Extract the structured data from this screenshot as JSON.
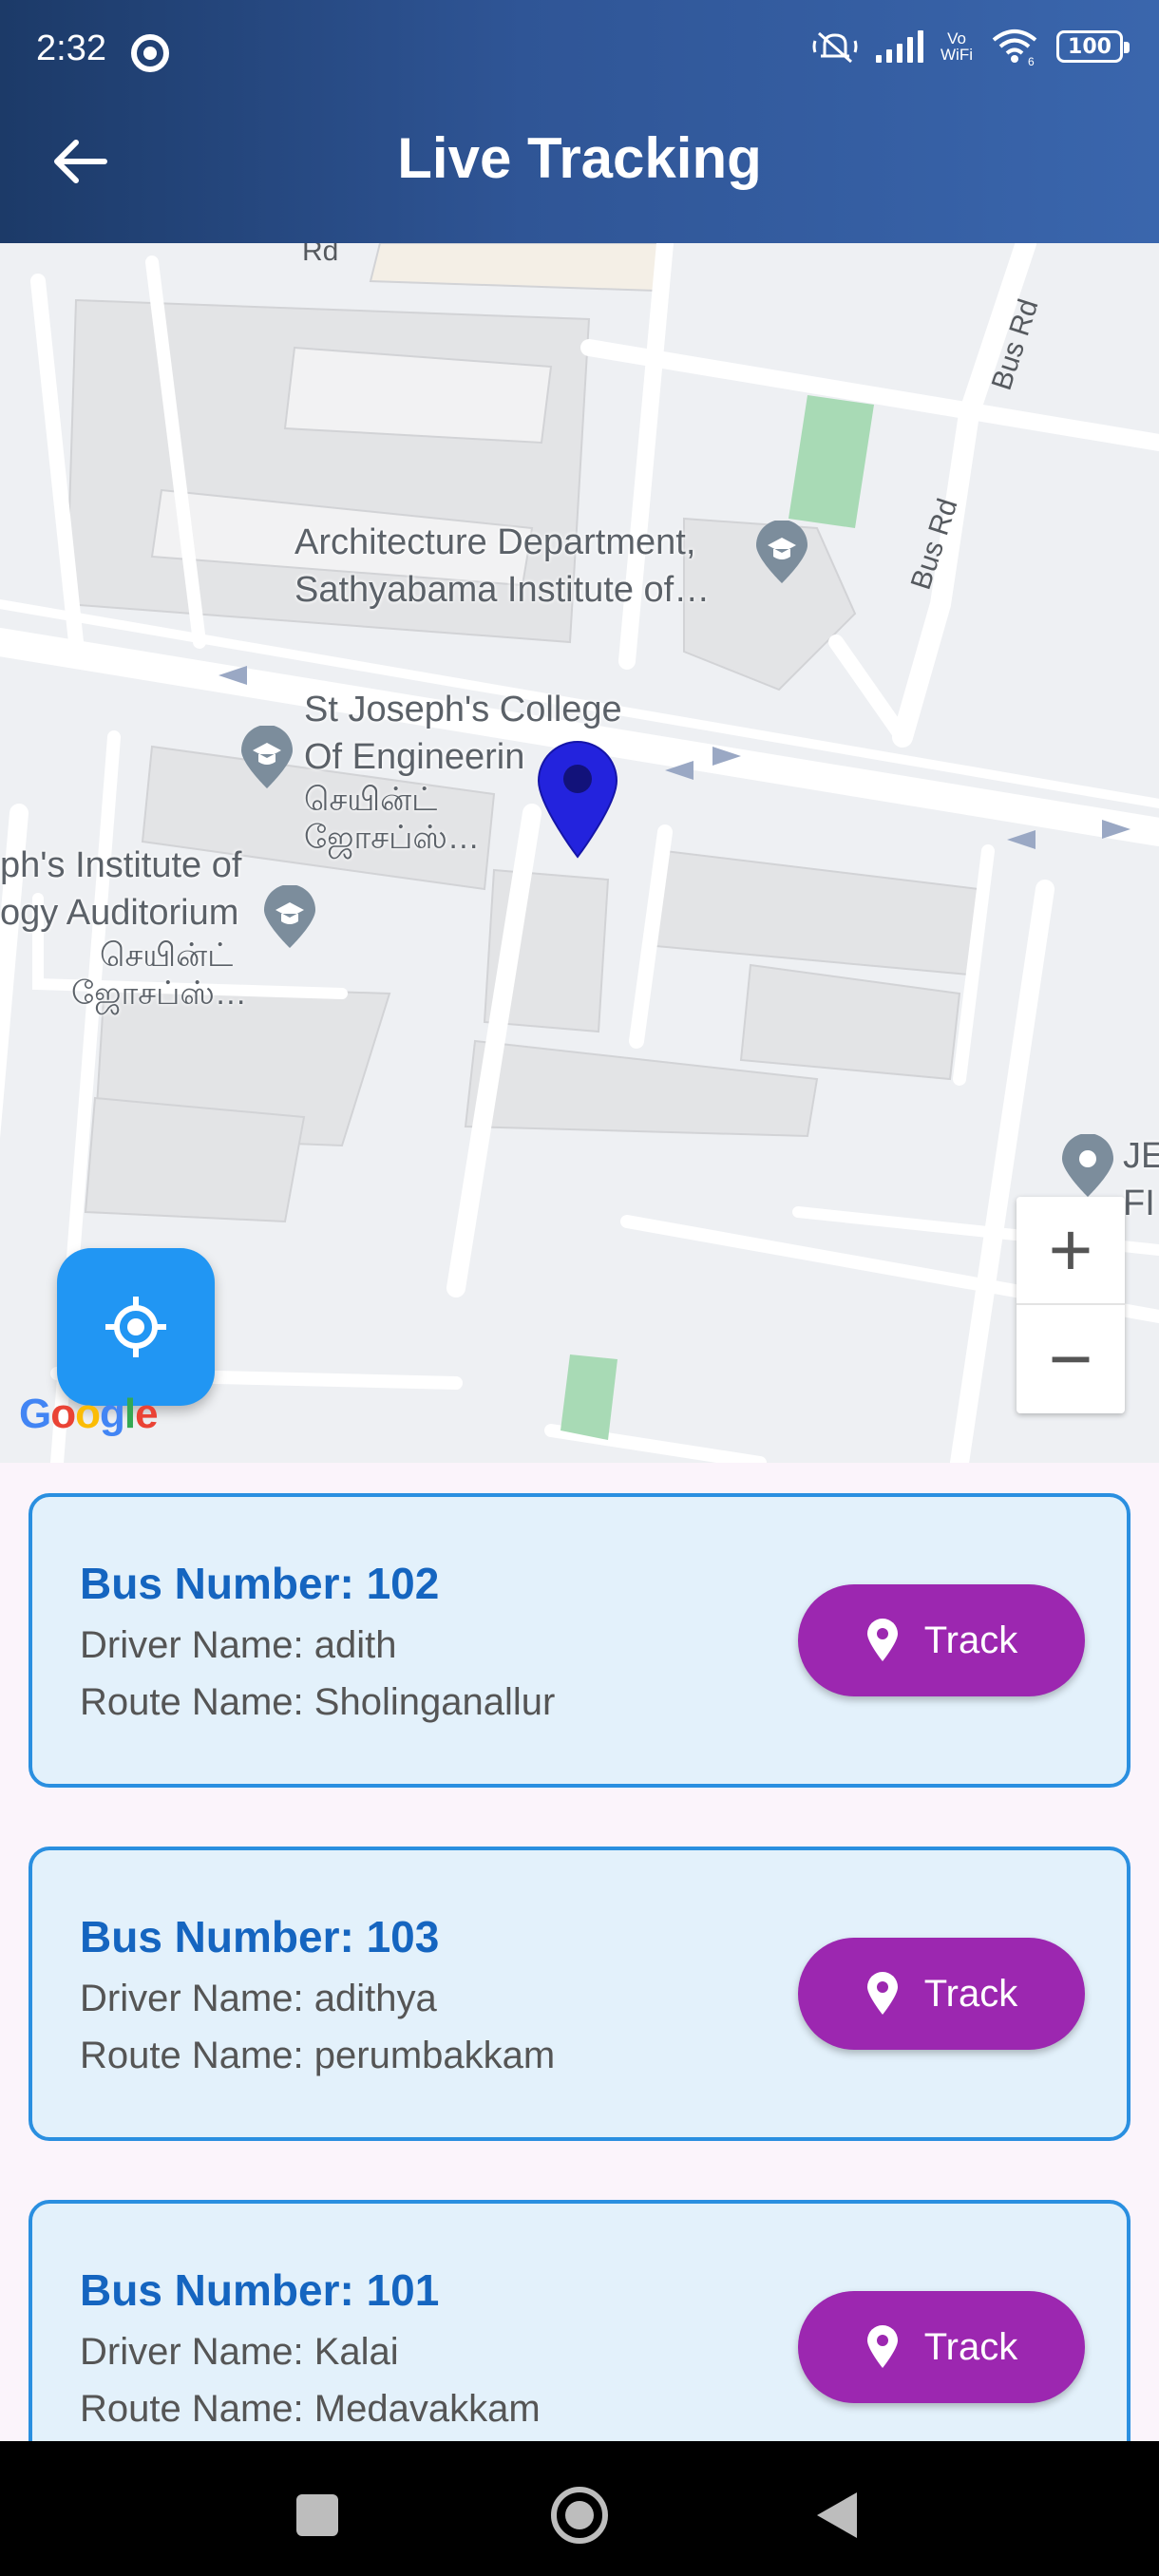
{
  "status_bar": {
    "time": "2:32",
    "wifi_label": "Vo\nWiFi",
    "wifi_sub": "6",
    "battery": "100"
  },
  "app_bar": {
    "title": "Live Tracking",
    "back_icon": "arrow-left-icon"
  },
  "map": {
    "road_labels": [
      "Bus Rd",
      "Bus Rd",
      "Rd"
    ],
    "places": [
      {
        "line1": "Architecture Department,",
        "line2": "Sathyabama Institute of…"
      },
      {
        "line1": "St Joseph's College",
        "line2": "Of Engineerin",
        "line3": "செயின்ட்",
        "line4": "ஜோசப்ஸ்…"
      },
      {
        "line1": "ph's Institute of",
        "line2": "ogy Auditorium",
        "line3": "செயின்ட்",
        "line4": "ஜோசப்ஸ்…"
      },
      {
        "line1": "JE",
        "line2": "FI"
      }
    ],
    "zoom_in": "+",
    "zoom_out": "−",
    "attribution": "Google",
    "locate_icon": "my-location-icon"
  },
  "buses": [
    {
      "bus_number": "Bus Number: 102",
      "driver": "Driver Name: adith",
      "route": "Route Name: Sholinganallur",
      "action": "Track"
    },
    {
      "bus_number": "Bus Number: 103",
      "driver": "Driver Name: adithya",
      "route": "Route Name: perumbakkam",
      "action": "Track"
    },
    {
      "bus_number": "Bus Number: 101",
      "driver": "Driver Name: Kalai",
      "route": "Route Name: Medavakkam",
      "action": "Track"
    }
  ],
  "colors": {
    "app_bar_start": "#1c3a68",
    "app_bar_end": "#3a66ad",
    "card_bg": "#e3f1fb",
    "card_border": "#2a8fe0",
    "bus_title": "#1565c0",
    "track_button": "#9c27b0",
    "locate_button": "#2196f3",
    "marker": "#2222dd"
  }
}
